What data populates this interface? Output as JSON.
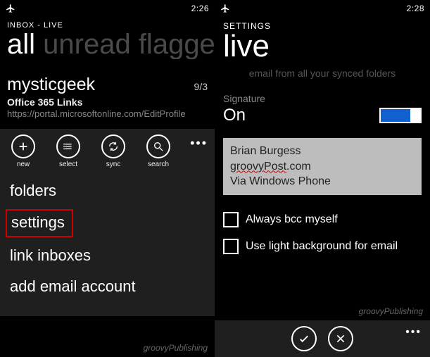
{
  "left": {
    "status": {
      "time": "2:26"
    },
    "context": "INBOX - LIVE",
    "pivot": {
      "active": "all",
      "inactive": "unread flagged"
    },
    "mail": {
      "from": "mysticgeek",
      "date": "9/3",
      "subject": "Office 365 Links",
      "preview": "https://portal.microsoftonline.com/EditProfile"
    },
    "appbar": {
      "new": "new",
      "select": "select",
      "sync": "sync",
      "search": "search"
    },
    "menu": {
      "folders": "folders",
      "settings": "settings",
      "link_inboxes": "link inboxes",
      "add_account": "add email account"
    },
    "watermark": "groovyPublishing"
  },
  "right": {
    "status": {
      "time": "2:28"
    },
    "section": "SETTINGS",
    "title": "live",
    "faded_line": "email from all your synced folders",
    "signature": {
      "label": "Signature",
      "state": "On",
      "line1": "Brian Burgess",
      "line2_a": "groovyPost",
      "line2_b": ".com",
      "line3": "Via Windows Phone"
    },
    "bcc_label": "Always bcc myself",
    "light_bg_label": "Use light background for email",
    "watermark": "groovyPublishing"
  }
}
